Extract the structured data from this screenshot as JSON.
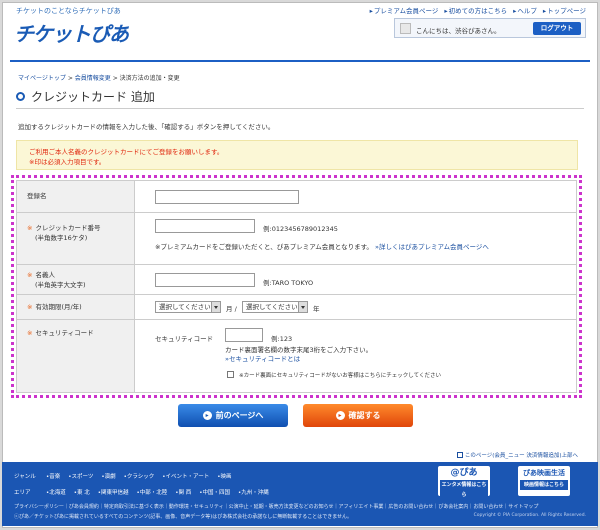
{
  "header": {
    "tagline": "チケットのことならチケットぴあ",
    "logo": "チケットぴあ",
    "nav": [
      "プレミアム会員ページ",
      "初めての方はこちら",
      "ヘルプ",
      "トップページ"
    ],
    "greeting": "こんにちは、渋谷ぴあさん。",
    "logout": "ログアウト"
  },
  "breadcrumb": {
    "items": [
      "マイページトップ",
      "会員情報変更"
    ],
    "current": "決済方法の追加・変更",
    "separator": ">"
  },
  "page": {
    "title": "クレジットカード 追加",
    "intro": "追加するクレジットカードの情報を入力した後、「確認する」ボタンを押してください。",
    "notice_line1": "ご利用ご本人名義のクレジットカードにてご登録をお願いします。",
    "notice_line2": "※印は必須入力項目です。"
  },
  "form": {
    "required_mark": "※",
    "reg_name": {
      "label": "登録名"
    },
    "card_number": {
      "label": "クレジットカード番号",
      "sublabel": "(半角数字16ケタ)",
      "example": "例:0123456789012345",
      "note": "※プレミアムカードをご登録いただくと、ぴあプレミアム会員となります。",
      "link": "»詳しくはぴあプレミアム会員ページへ"
    },
    "holder": {
      "label": "名義人",
      "sublabel": "(半角英字大文字)",
      "example": "例:TARO TOKYO"
    },
    "expiry": {
      "label": "有効期限(月/年)",
      "month_select": "選択してください",
      "month_unit": "月 /",
      "year_select": "選択してください",
      "year_unit": "年"
    },
    "security": {
      "label": "セキュリティコード",
      "field_label": "セキュリティコード",
      "example": "例:123",
      "note": "カード裏面署名欄の数字末尾3桁をご入力下さい。",
      "link": "»セキュリティコードとは",
      "checkbox_label": "※カード裏面にセキュリティコードがないお客様はこちらにチェックしてください"
    }
  },
  "buttons": {
    "back": "前のページへ",
    "confirm": "確認する"
  },
  "pagetop": "このページ(会員_ニュー 決済情報追加)上部へ",
  "footer": {
    "genre_heading": "ジャンル",
    "genres": [
      "•音楽",
      "•スポーツ",
      "•演劇",
      "•クラシック",
      "•イベント・アート",
      "•映画"
    ],
    "area_heading": "エリア",
    "areas": [
      "•北海道",
      "•東 北",
      "•関東甲信越",
      "•中部・北陸",
      "•関 西",
      "•中国・四国",
      "•九州・沖縄"
    ],
    "banner1_top": "@ぴあ",
    "banner1_bottom": "エンタメ情報はこちら",
    "banner2_top": "ぴあ映画生活",
    "banner2_bottom": "映画情報はこちら",
    "links": "プライバシーポリシー｜ぴあ会員規約｜特定商取引法に基づく表示｜動作環境・セキュリティ｜公演中止・延期・販売方法変更などのお知らせ｜アフィリエイト事業｜広告のお問い合わせ｜ぴあ会社案内｜お問い合わせ｜サイトマップ",
    "copyright_note": "ⓒぴあ／チケットぴあに掲載されているすべてのコンテンツ(記事、画像、音声データ等)はぴあ株式会社の承諾なしに無断転載することはできません。",
    "copyright": "Copyright © PIA Corporation. All Rights Reserved."
  }
}
